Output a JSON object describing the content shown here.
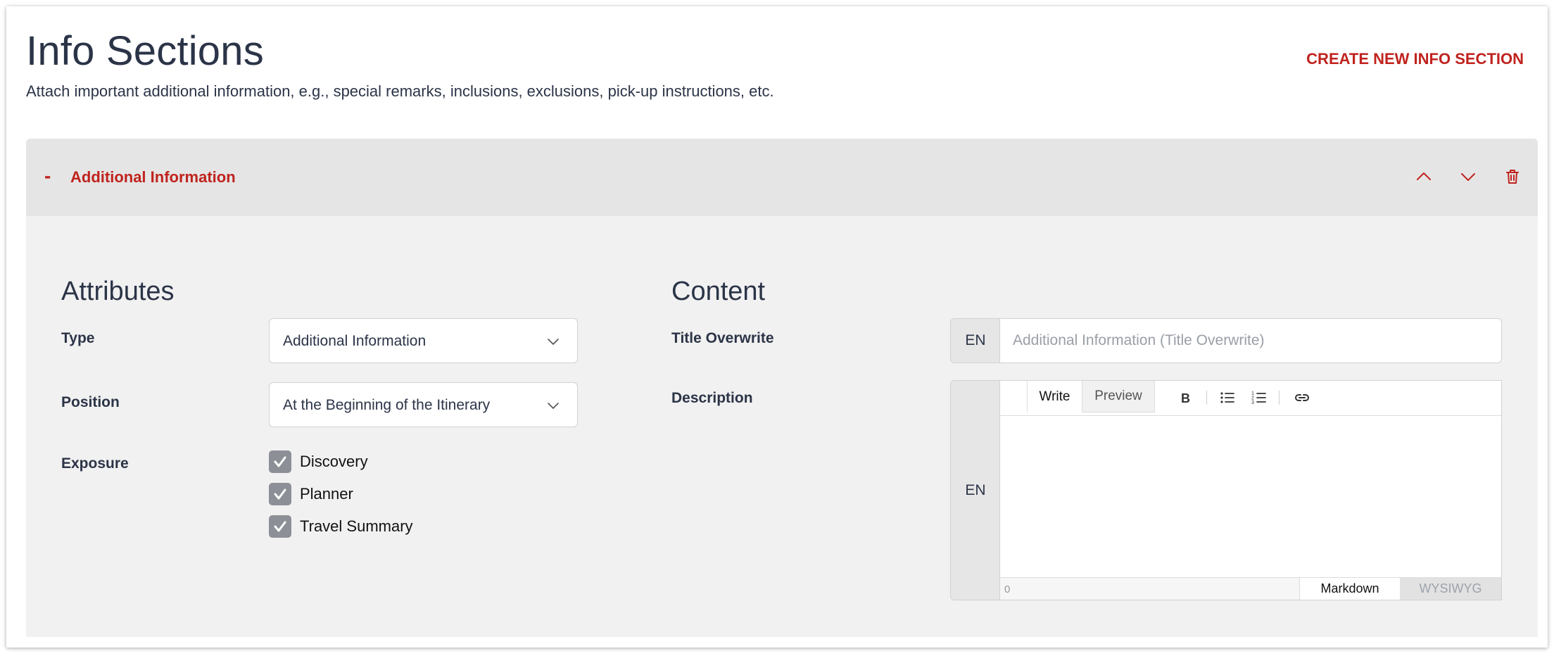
{
  "header": {
    "title": "Info Sections",
    "subtitle": "Attach important additional information, e.g., special remarks, inclusions, exclusions, pick-up instructions, etc.",
    "create_button": "CREATE NEW INFO SECTION"
  },
  "section": {
    "toggle_symbol": "-",
    "name": "Additional Information",
    "actions": [
      "chevron-up-icon",
      "chevron-down-icon",
      "trash-icon"
    ]
  },
  "attributes": {
    "heading": "Attributes",
    "type_label": "Type",
    "type_value": "Additional Information",
    "position_label": "Position",
    "position_value": "At the Beginning of the Itinerary",
    "exposure_label": "Exposure",
    "exposure_options": [
      {
        "label": "Discovery",
        "checked": true
      },
      {
        "label": "Planner",
        "checked": true
      },
      {
        "label": "Travel Summary",
        "checked": true
      }
    ]
  },
  "content": {
    "heading": "Content",
    "title_label": "Title Overwrite",
    "title_lang": "EN",
    "title_placeholder": "Additional Information (Title Overwrite)",
    "description_label": "Description",
    "description_lang": "EN",
    "editor": {
      "tab_write": "Write",
      "tab_preview": "Preview",
      "tools": [
        "bold-icon",
        "bullet-list-icon",
        "numbered-list-icon",
        "link-icon"
      ],
      "char_count": "0",
      "mode_markdown": "Markdown",
      "mode_wysiwyg": "WYSIWYG"
    }
  },
  "colors": {
    "accent": "#c0231e",
    "text": "#2b3447",
    "header_bg": "#e5e5e5",
    "body_bg": "#f1f1f1",
    "checkbox": "#8c8f96"
  }
}
